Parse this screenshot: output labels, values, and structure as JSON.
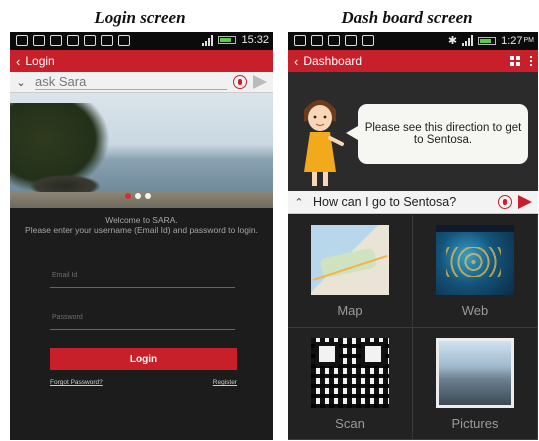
{
  "captions": {
    "left": "Login screen",
    "right": "Dash board screen"
  },
  "login_screen": {
    "status_time": "15:32",
    "appbar_title": "Login",
    "ask_text": "ask Sara",
    "welcome_line1": "Welcome to SARA.",
    "welcome_line2": "Please enter your username (Email Id) and password to login.",
    "email_placeholder": "Email Id",
    "password_placeholder": "Password",
    "login_button": "Login",
    "forgot_password": "Forgot Password?",
    "register": "Register",
    "carousel": {
      "count": 3,
      "active": 0
    }
  },
  "dashboard_screen": {
    "status_time": "1:27",
    "status_ampm": "PM",
    "appbar_title": "Dashboard",
    "bubble_text": "Please see this direction to get to Sentosa.",
    "question": "How can I go to Sentosa?",
    "tiles": [
      {
        "label": "Map",
        "icon": "map-thumbnail"
      },
      {
        "label": "Web",
        "icon": "web-thumbnail"
      },
      {
        "label": "Scan",
        "icon": "qr-code-thumbnail"
      },
      {
        "label": "Pictures",
        "icon": "pictures-thumbnail"
      }
    ]
  },
  "colors": {
    "brand_red": "#c8202a",
    "dark_bg": "#1c1c1c"
  }
}
